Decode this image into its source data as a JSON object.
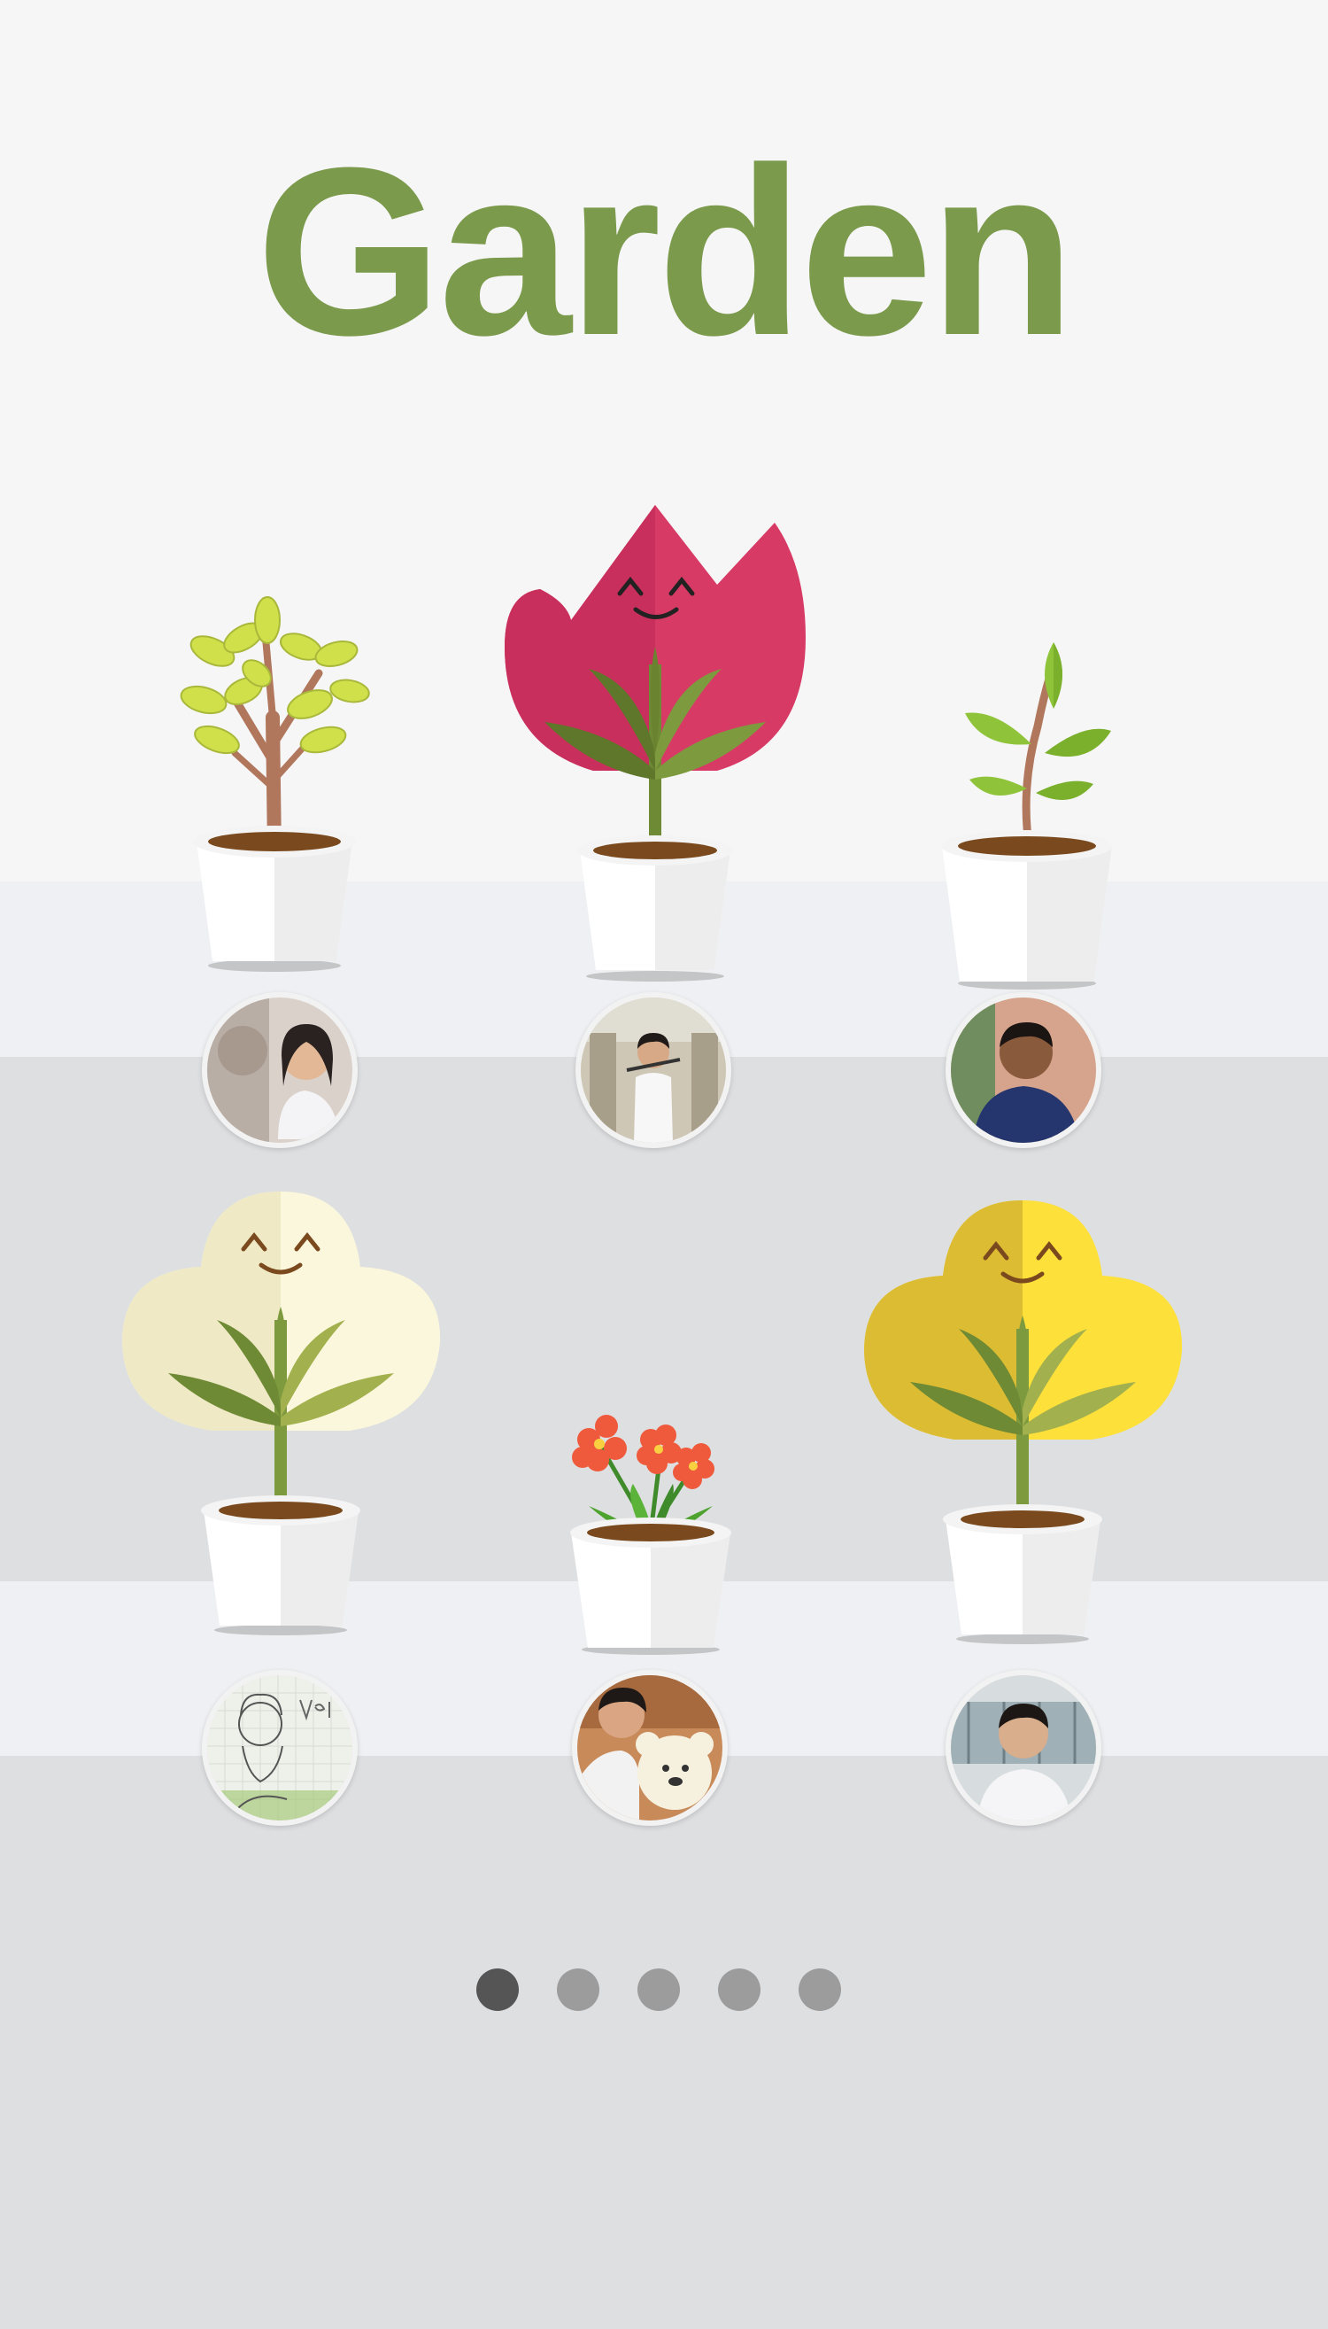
{
  "title": "Garden",
  "colors": {
    "title": "#7b9a4c",
    "page_background": "#f6f6f7",
    "shelf_light": "#eff0f3",
    "shelf_dark": "#dedfe1",
    "dot_active": "#555555",
    "dot_inactive": "#9c9c9c"
  },
  "plants": [
    {
      "icon": "sapling-tree-icon",
      "row": 1,
      "col": 1
    },
    {
      "icon": "pink-tulip-face-icon",
      "row": 1,
      "col": 2
    },
    {
      "icon": "seedling-icon",
      "row": 1,
      "col": 3
    },
    {
      "icon": "cream-bush-face-icon",
      "row": 2,
      "col": 1
    },
    {
      "icon": "red-flowers-icon",
      "row": 2,
      "col": 2
    },
    {
      "icon": "yellow-bush-face-icon",
      "row": 2,
      "col": 3
    }
  ],
  "avatars": [
    {
      "icon": "user-avatar-icon",
      "row": 1,
      "col": 1
    },
    {
      "icon": "user-avatar-icon",
      "row": 1,
      "col": 2
    },
    {
      "icon": "user-avatar-icon",
      "row": 1,
      "col": 3
    },
    {
      "icon": "user-avatar-icon",
      "row": 2,
      "col": 1
    },
    {
      "icon": "user-avatar-icon",
      "row": 2,
      "col": 2
    },
    {
      "icon": "user-avatar-icon",
      "row": 2,
      "col": 3
    }
  ],
  "pagination": {
    "pages": 5,
    "current": 1
  }
}
